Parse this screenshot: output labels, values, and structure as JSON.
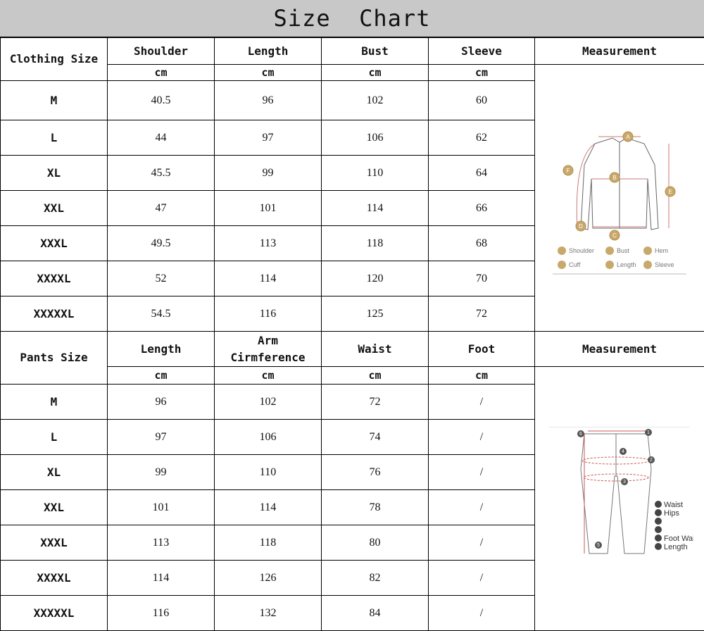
{
  "title": "Size  Chart",
  "clothing": {
    "size_header": "Clothing Size",
    "columns": [
      "Shoulder",
      "Length",
      "Bust",
      "Sleeve"
    ],
    "measurement_header": "Measurement",
    "unit": "cm",
    "rows": [
      [
        "M",
        "40.5",
        "96",
        "102",
        "60"
      ],
      [
        "L",
        "44",
        "97",
        "106",
        "62"
      ],
      [
        "XL",
        "45.5",
        "99",
        "110",
        "64"
      ],
      [
        "XXL",
        "47",
        "101",
        "114",
        "66"
      ],
      [
        "XXXL",
        "49.5",
        "113",
        "118",
        "68"
      ],
      [
        "XXXXL",
        "52",
        "114",
        "120",
        "70"
      ],
      [
        "XXXXXL",
        "54.5",
        "116",
        "125",
        "72"
      ]
    ],
    "diagram": {
      "markers": [
        "A",
        "B",
        "C",
        "D",
        "E",
        "F"
      ],
      "legend": [
        {
          "key": "A",
          "label": "Shoulder"
        },
        {
          "key": "B",
          "label": "Bust"
        },
        {
          "key": "C",
          "label": "Hem"
        },
        {
          "key": "D",
          "label": "Cuff"
        },
        {
          "key": "E",
          "label": "Length"
        },
        {
          "key": "F",
          "label": "Sleeve"
        }
      ]
    }
  },
  "pants": {
    "size_header": "Pants Size",
    "columns": [
      "Length",
      "Arm\nCirmference",
      "Waist",
      "Foot"
    ],
    "measurement_header": "Measurement",
    "unit": "cm",
    "rows": [
      [
        "M",
        "96",
        "102",
        "72",
        "/"
      ],
      [
        "L",
        "97",
        "106",
        "74",
        "/"
      ],
      [
        "XL",
        "99",
        "110",
        "76",
        "/"
      ],
      [
        "XXL",
        "101",
        "114",
        "78",
        "/"
      ],
      [
        "XXXL",
        "113",
        "118",
        "80",
        "/"
      ],
      [
        "XXXXL",
        "114",
        "126",
        "82",
        "/"
      ],
      [
        "XXXXXL",
        "116",
        "132",
        "84",
        "/"
      ]
    ],
    "diagram": {
      "markers": [
        "1",
        "2",
        "3",
        "4",
        "5",
        "6"
      ],
      "legend": [
        {
          "key": "1",
          "label": "Waist"
        },
        {
          "key": "2",
          "label": "Hips"
        },
        {
          "key": "3",
          "label": ""
        },
        {
          "key": "4",
          "label": ""
        },
        {
          "key": "5",
          "label": "Foot Wai"
        },
        {
          "key": "6",
          "label": "Length"
        }
      ]
    }
  }
}
